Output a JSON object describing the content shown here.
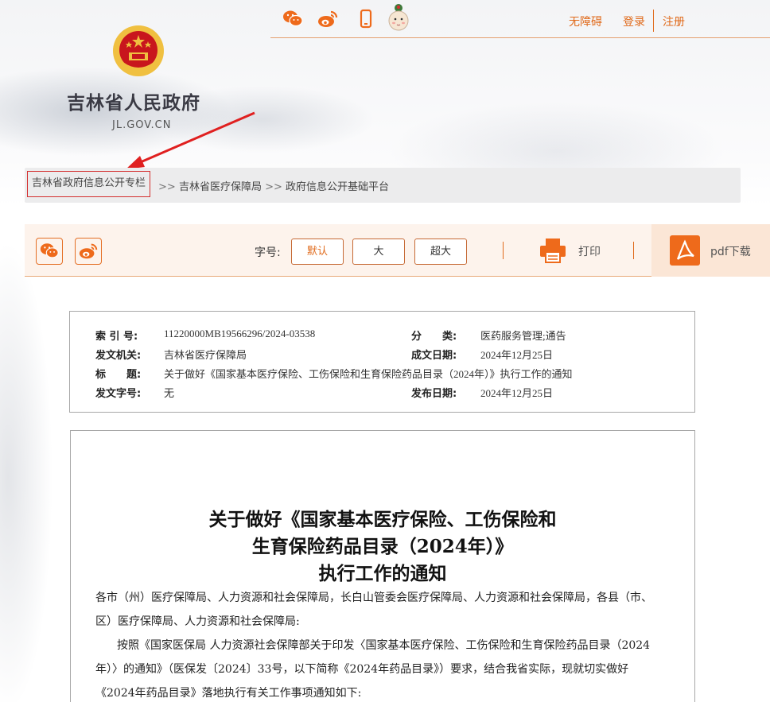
{
  "header": {
    "accessibility_label": "无障碍",
    "login_label": "登录",
    "register_label": "注册",
    "site_title": "吉林省人民政府",
    "site_domain": "JL.GOV.CN",
    "icons": [
      "wechat-icon",
      "weibo-icon",
      "mobile-icon",
      "mascot-icon"
    ]
  },
  "breadcrumb": {
    "items": [
      "吉林省政府信息公开专栏",
      "吉林省医疗保障局",
      "政府信息公开基础平台"
    ],
    "separator": ">>"
  },
  "toolbar": {
    "font_label": "字号:",
    "font_sizes": [
      "默认",
      "大",
      "超大"
    ],
    "print_label": "打印",
    "pdf_label": "pdf下载"
  },
  "meta": {
    "index_key": "索 引 号:",
    "index_val": "11220000MB19566296/2024-03538",
    "category_key": "分　　类:",
    "category_val": "医药服务管理;通告",
    "issuer_key": "发文机关:",
    "issuer_val": "吉林省医疗保障局",
    "written_date_key": "成文日期:",
    "written_date_val": "2024年12月25日",
    "title_key": "标　　题:",
    "title_val": "关于做好《国家基本医疗保险、工伤保险和生育保险药品目录（2024年）》执行工作的通知",
    "doc_no_key": "发文字号:",
    "doc_no_val": "无",
    "publish_date_key": "发布日期:",
    "publish_date_val": "2024年12月25日"
  },
  "document": {
    "title_line1": "关于做好《国家基本医疗保险、工伤保险和",
    "title_line2": "生育保险药品目录（2024年）》",
    "title_line3": "执行工作的通知",
    "para1_line1": "各市（州）医疗保障局、人力资源和社会保障局，长白山管委会医疗保障局、人力资源和社会保障局，各县（市、",
    "para1_line2": "区）医疗保障局、人力资源和社会保障局:",
    "para2_line1": "按照《国家医保局 人力资源社会保障部关于印发〈国家基本医疗保险、工伤保险和生育保险药品目录（2024",
    "para2_line2": "年）〉的通知》（医保发〔2024〕33号，以下简称《2024年药品目录》）要求，结合我省实际，现就切实做好",
    "para2_line3": "《2024年药品目录》落地执行有关工作事项通知如下:"
  },
  "colors": {
    "accent": "#e06a1b",
    "highlight_border": "#d43030",
    "emblem_red": "#c8161d",
    "emblem_gold": "#f0c040"
  }
}
